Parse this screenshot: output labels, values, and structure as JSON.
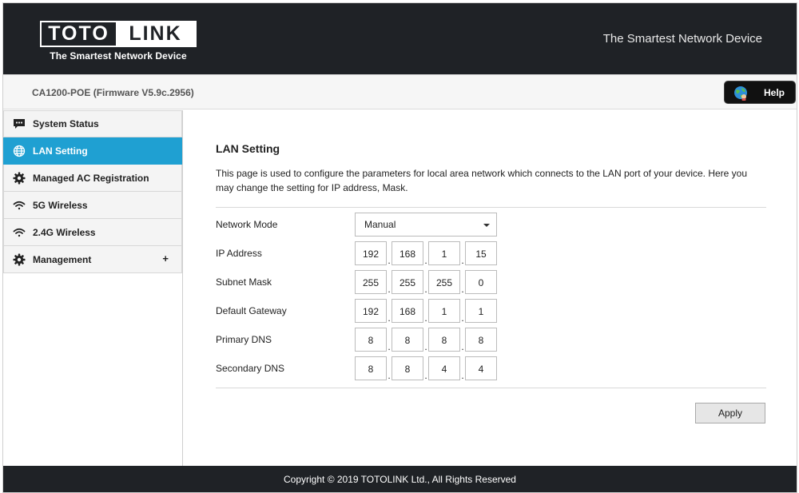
{
  "header": {
    "logo_left": "TOTO",
    "logo_right": "LINK",
    "logo_tagline": "The Smartest Network Device",
    "slogan": "The Smartest Network Device"
  },
  "subheader": {
    "device_name": "CA1200-POE (Firmware V5.9c.2956)",
    "help_label": "Help"
  },
  "sidebar": {
    "items": [
      {
        "label": "System Status",
        "icon": "chat-icon",
        "active": false
      },
      {
        "label": "LAN Setting",
        "icon": "globe-icon",
        "active": true
      },
      {
        "label": "Managed AC Registration",
        "icon": "gear-icon",
        "active": false
      },
      {
        "label": "5G Wireless",
        "icon": "wifi-icon",
        "active": false
      },
      {
        "label": "2.4G Wireless",
        "icon": "wifi-icon",
        "active": false
      },
      {
        "label": "Management",
        "icon": "gear-icon",
        "active": false,
        "expand": "+"
      }
    ]
  },
  "main": {
    "title": "LAN Setting",
    "description": "This page is used to configure the parameters for local area network which connects to the LAN port of your device. Here you may change the setting for IP address, Mask.",
    "network_mode": {
      "label": "Network Mode",
      "value": "Manual"
    },
    "fields": [
      {
        "label": "IP Address",
        "octets": [
          "192",
          "168",
          "1",
          "15"
        ]
      },
      {
        "label": "Subnet Mask",
        "octets": [
          "255",
          "255",
          "255",
          "0"
        ]
      },
      {
        "label": "Default Gateway",
        "octets": [
          "192",
          "168",
          "1",
          "1"
        ]
      },
      {
        "label": "Primary DNS",
        "octets": [
          "8",
          "8",
          "8",
          "8"
        ]
      },
      {
        "label": "Secondary DNS",
        "octets": [
          "8",
          "8",
          "4",
          "4"
        ]
      }
    ],
    "apply_label": "Apply"
  },
  "footer": {
    "copyright": "Copyright © 2019 TOTOLINK Ltd., All Rights Reserved"
  },
  "colors": {
    "header_bg": "#1f2226",
    "active_nav": "#1fa0d2"
  }
}
